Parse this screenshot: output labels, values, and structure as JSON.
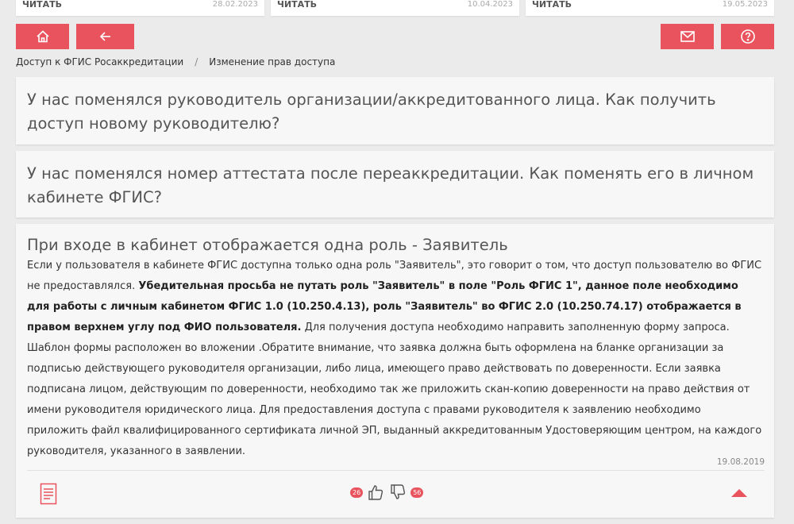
{
  "cards": [
    {
      "read_label": "ЧИТАТЬ",
      "date": "28.02.2023"
    },
    {
      "read_label": "ЧИТАТЬ",
      "date": "10.04.2023"
    },
    {
      "read_label": "ЧИТАТЬ",
      "date": "19.05.2023"
    }
  ],
  "toolbar": {
    "home_icon": "home-icon",
    "back_icon": "arrow-left-icon",
    "mail_icon": "envelope-icon",
    "help_icon": "question-icon",
    "accent": "#e9535d"
  },
  "breadcrumb": {
    "item1": "Доступ к ФГИС Росаккредитации",
    "separator": "/",
    "item2": "Изменение прав доступа"
  },
  "questions": [
    {
      "title": "У нас поменялся руководитель организации/аккредитованного лица. Как получить доступ новому руководителю?"
    },
    {
      "title": "У нас поменялся номер аттестата после переаккредитации. Как поменять его в личном кабинете ФГИС?"
    },
    {
      "title": "При входе в кабинет отображается одна роль - Заявитель",
      "answer_part1": "Если у пользователя в кабинете ФГИС доступна только одна роль \"Заявитель\", это говорит о том, что доступ пользователю во ФГИС не предоставлялся. ",
      "answer_bold": "Убедительная просьба не путать роль \"Заявитель\" в поле \"Роль ФГИС 1\", данное поле необходимо для работы с личным кабинетом ФГИС 1.0 (10.250.4.13), роль \"Заявитель\" во ФГИС 2.0 (10.250.74.17) отображается в правом верхнем углу под ФИО пользователя.",
      "answer_part2": " Для получения доступа необходимо направить заполненную форму запроса. Шаблон формы расположен во вложении .Обратите внимание, что заявка должна быть оформлена на бланке организации за подписью действующего руководителя организации, либо лица, имеющего право действовать по доверенности. Если заявка подписана лицом, действующим по доверенности, необходимо так же приложить скан-копию доверенности на право действия от имени руководителя юридического лица. Для предоставления доступа с правами руководителя к заявлению необходимо приложить файл квалифицированного сертификата личной ЭП, выданный аккредитованным Удостоверяющим центром, на каждого руководителя, указанного в заявлении.",
      "date": "19.08.2019",
      "likes": "26",
      "dislikes": "56"
    }
  ]
}
